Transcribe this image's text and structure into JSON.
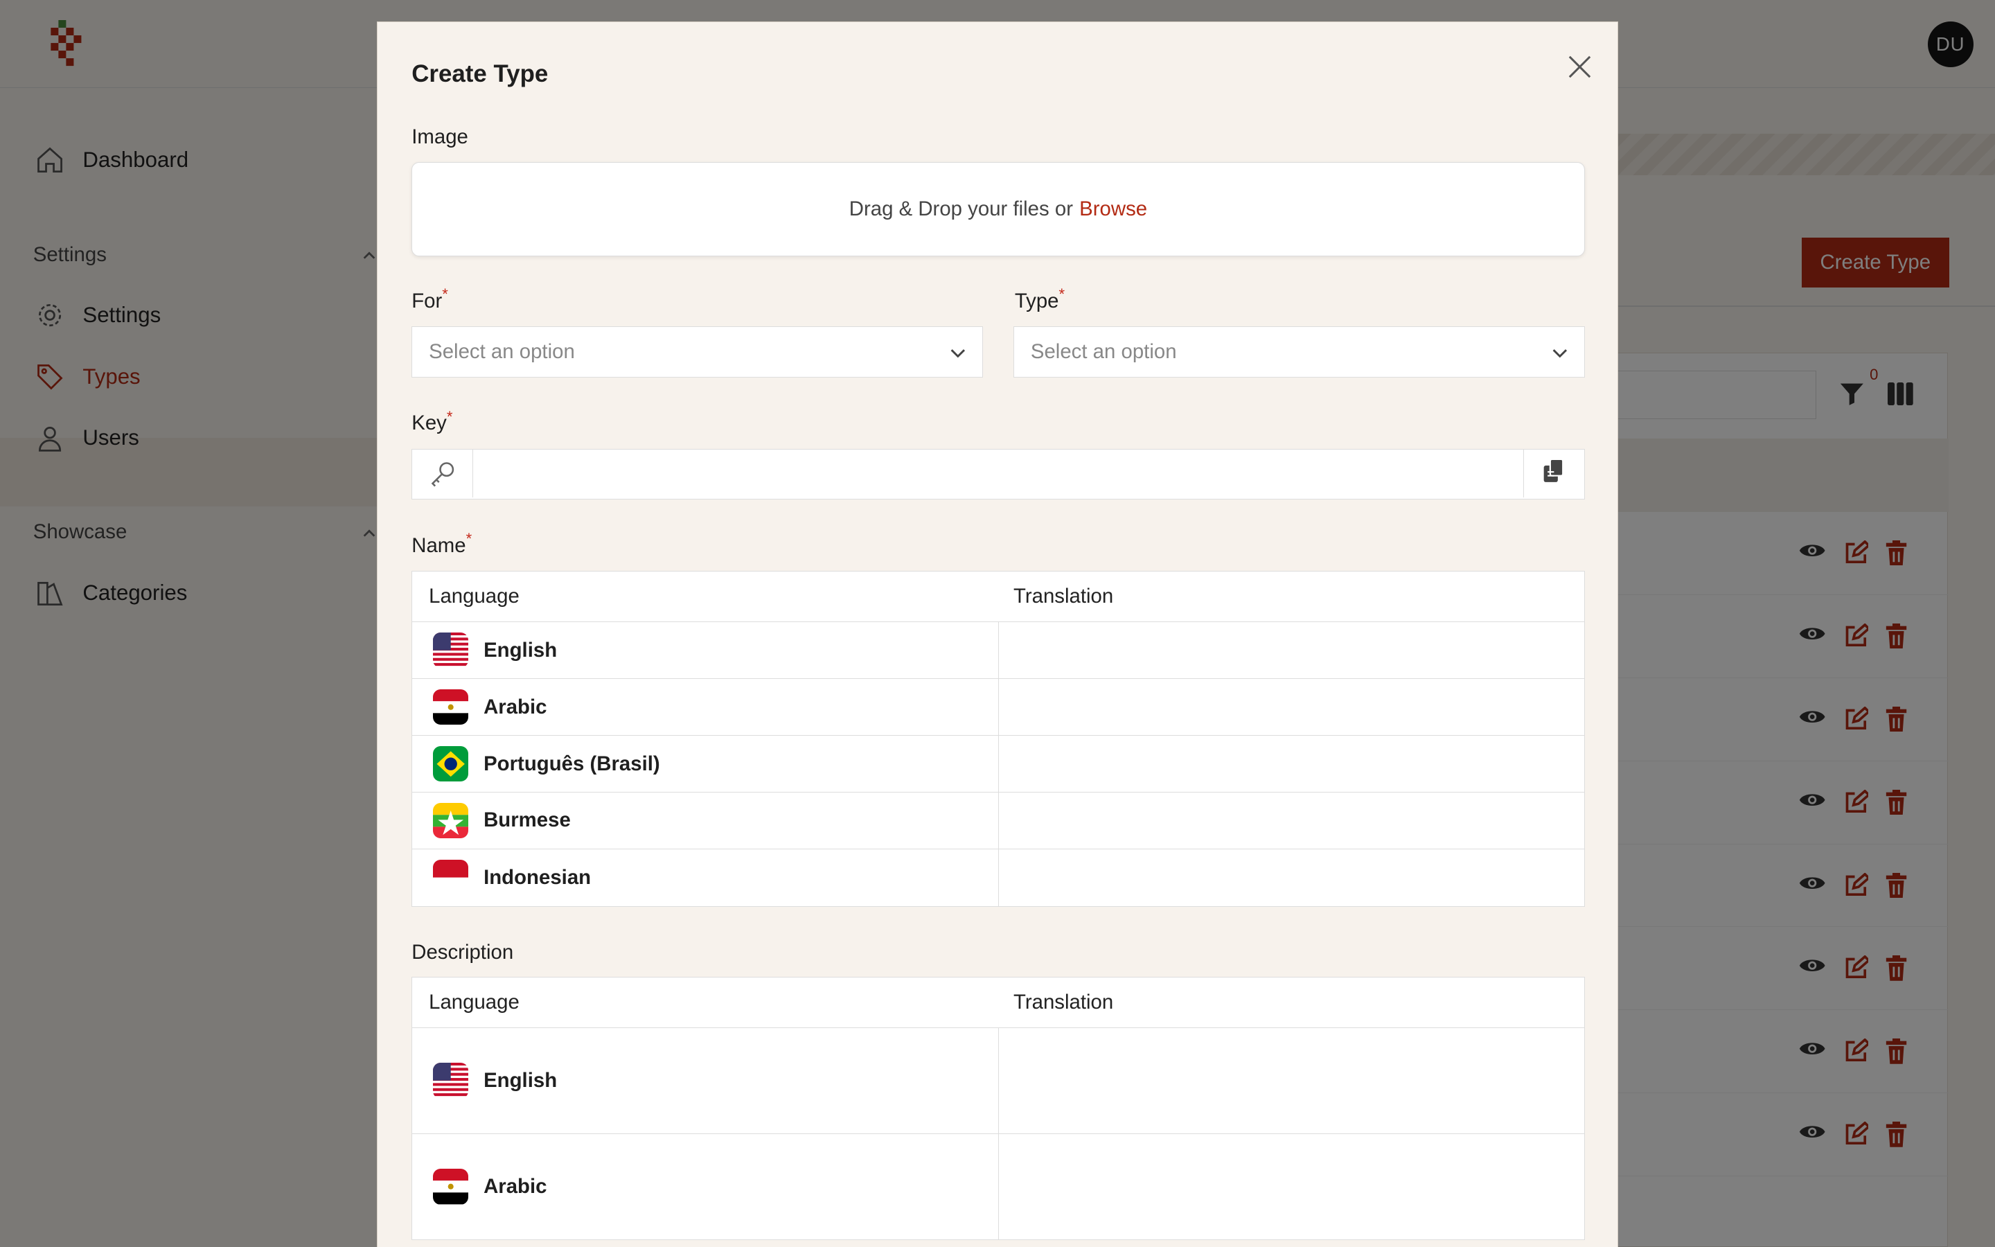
{
  "user": {
    "initials": "DU"
  },
  "sidebar": {
    "items": [
      {
        "label": "Dashboard",
        "icon": "home-icon"
      },
      {
        "label": "Settings",
        "icon": "gear-icon"
      },
      {
        "label": "Types",
        "icon": "tag-icon"
      },
      {
        "label": "Users",
        "icon": "user-icon"
      },
      {
        "label": "Categories",
        "icon": "categories-icon"
      }
    ],
    "sections": [
      "Settings",
      "Showcase"
    ],
    "active": "Types"
  },
  "page": {
    "create_button": "Create Type",
    "filter_count": "0",
    "row_actions": [
      "eye-icon",
      "edit-icon",
      "trash-icon"
    ]
  },
  "modal": {
    "title": "Create Type",
    "image_label": "Image",
    "dropzone_text": "Drag & Drop your files or",
    "dropzone_link": "Browse",
    "for_label": "For",
    "type_label": "Type",
    "required_mark": "*",
    "for_placeholder": "Select an option",
    "type_placeholder": "Select an option",
    "key_label": "Key",
    "key_value": "",
    "name_label": "Name",
    "description_label": "Description",
    "col_language": "Language",
    "col_translation": "Translation",
    "name_languages": [
      "English",
      "Arabic",
      "Português (Brasil)",
      "Burmese",
      "Indonesian"
    ],
    "description_languages": [
      "English",
      "Arabic"
    ]
  },
  "colors": {
    "accent": "#b32b14",
    "required": "#c4281a"
  }
}
